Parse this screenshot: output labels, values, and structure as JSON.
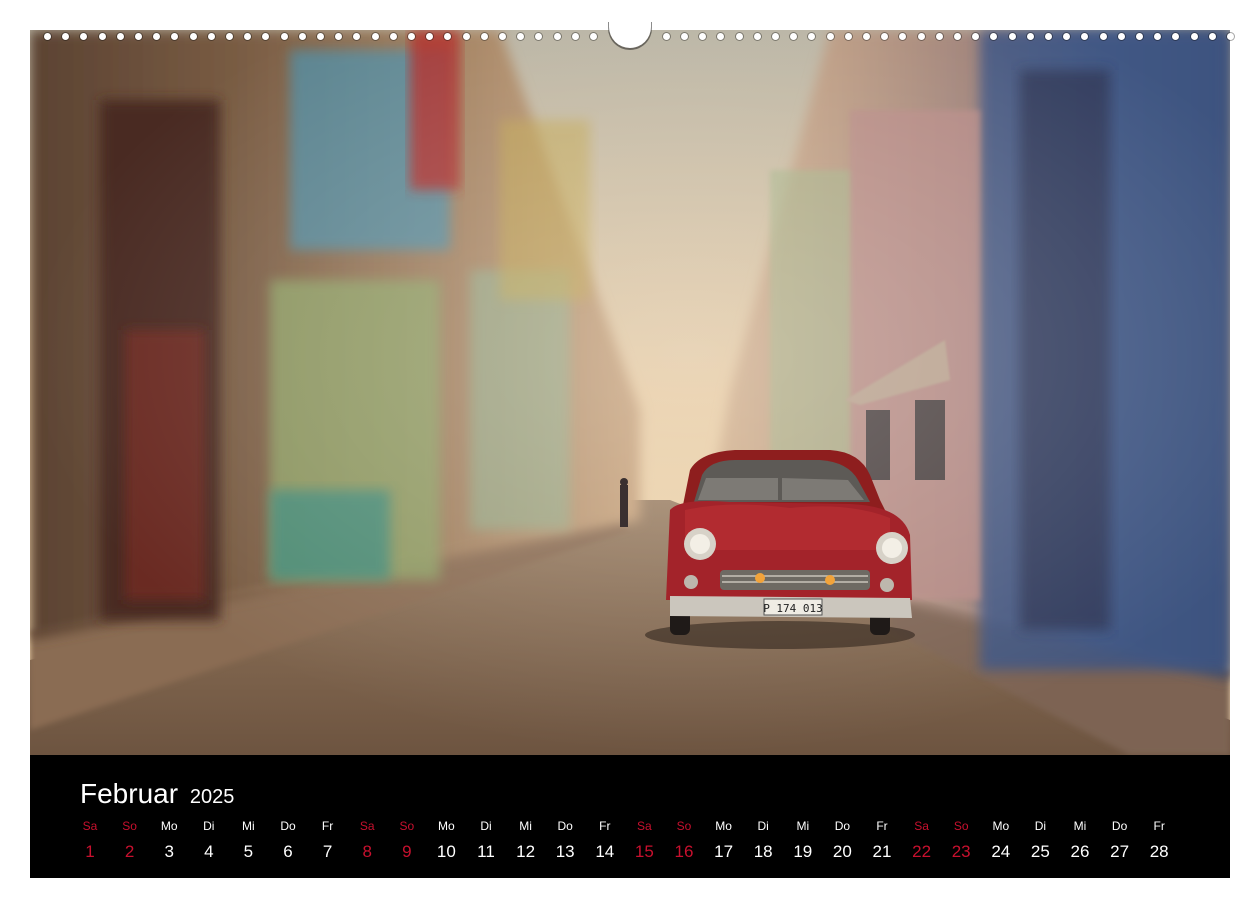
{
  "calendar": {
    "month": "Februar",
    "year": "2025",
    "weekend_color": "#c8102e",
    "days": [
      {
        "weekday": "Sa",
        "day": "1",
        "weekend": true
      },
      {
        "weekday": "So",
        "day": "2",
        "weekend": true
      },
      {
        "weekday": "Mo",
        "day": "3",
        "weekend": false
      },
      {
        "weekday": "Di",
        "day": "4",
        "weekend": false
      },
      {
        "weekday": "Mi",
        "day": "5",
        "weekend": false
      },
      {
        "weekday": "Do",
        "day": "6",
        "weekend": false
      },
      {
        "weekday": "Fr",
        "day": "7",
        "weekend": false
      },
      {
        "weekday": "Sa",
        "day": "8",
        "weekend": true
      },
      {
        "weekday": "So",
        "day": "9",
        "weekend": true
      },
      {
        "weekday": "Mo",
        "day": "10",
        "weekend": false
      },
      {
        "weekday": "Di",
        "day": "11",
        "weekend": false
      },
      {
        "weekday": "Mi",
        "day": "12",
        "weekend": false
      },
      {
        "weekday": "Do",
        "day": "13",
        "weekend": false
      },
      {
        "weekday": "Fr",
        "day": "14",
        "weekend": false
      },
      {
        "weekday": "Sa",
        "day": "15",
        "weekend": true
      },
      {
        "weekday": "So",
        "day": "16",
        "weekend": true
      },
      {
        "weekday": "Mo",
        "day": "17",
        "weekend": false
      },
      {
        "weekday": "Di",
        "day": "18",
        "weekend": false
      },
      {
        "weekday": "Mi",
        "day": "19",
        "weekend": false
      },
      {
        "weekday": "Do",
        "day": "20",
        "weekend": false
      },
      {
        "weekday": "Fr",
        "day": "21",
        "weekend": false
      },
      {
        "weekday": "Sa",
        "day": "22",
        "weekend": true
      },
      {
        "weekday": "So",
        "day": "23",
        "weekend": true
      },
      {
        "weekday": "Mo",
        "day": "24",
        "weekend": false
      },
      {
        "weekday": "Di",
        "day": "25",
        "weekend": false
      },
      {
        "weekday": "Mi",
        "day": "26",
        "weekend": false
      },
      {
        "weekday": "Do",
        "day": "27",
        "weekend": false
      },
      {
        "weekday": "Fr",
        "day": "28",
        "weekend": false
      }
    ]
  },
  "photo": {
    "license_plate": "P 174 013",
    "icon": "classic-car-street-photo"
  }
}
